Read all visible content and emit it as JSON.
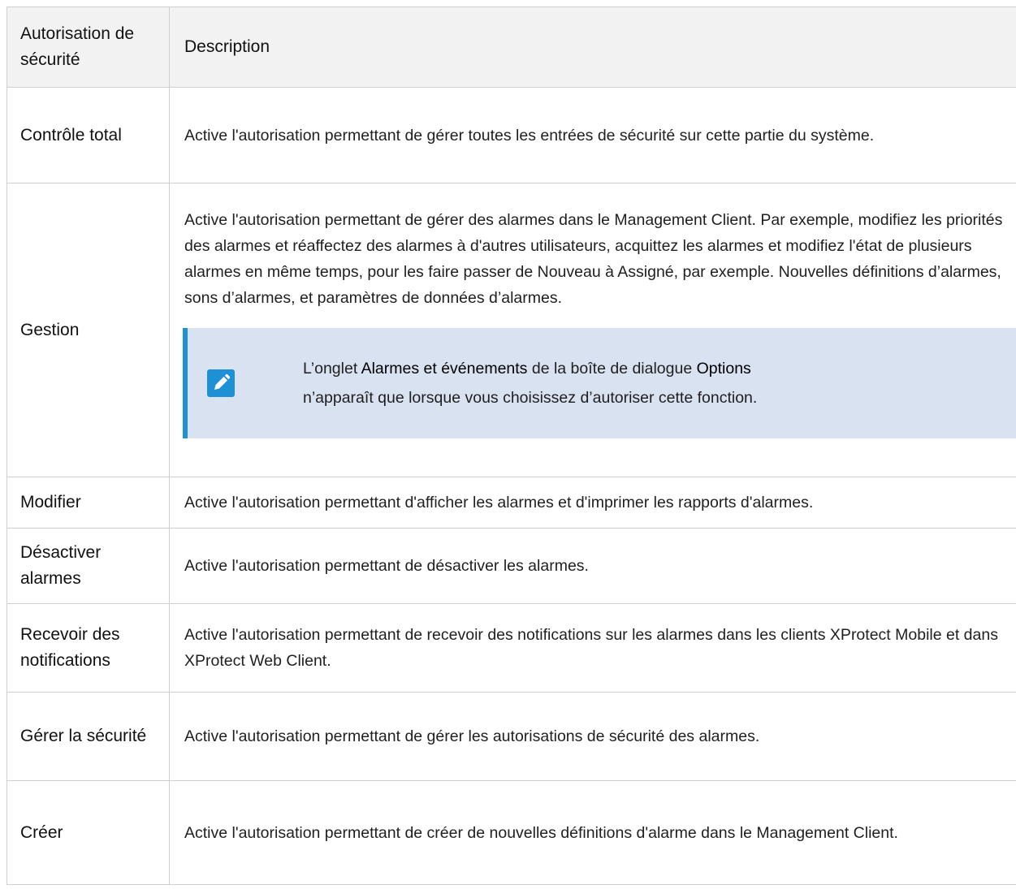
{
  "table": {
    "headers": {
      "permission": "Autorisation de sécurité",
      "description": "Description"
    },
    "rows": [
      {
        "name": "Contrôle total",
        "description": "Active l'autorisation permettant de gérer toutes les entrées de sécurité sur cette partie du système."
      },
      {
        "name": "Gestion",
        "description": "Active l'autorisation permettant de gérer des alarmes dans le Management Client. Par exemple, modifiez les priorités des alarmes et réaffectez des alarmes à d'autres utilisateurs, acquittez les alarmes et modifiez l'état de plusieurs alarmes en même temps, pour les faire passer de Nouveau à Assigné, par exemple. Nouvelles définitions d’alarmes, sons d’alarmes, et paramètres de données d’alarmes."
      },
      {
        "name": "Modifier",
        "description": "Active l'autorisation permettant d'afficher les alarmes et d'imprimer les rapports d'alarmes."
      },
      {
        "name": "Désactiver alarmes",
        "description": "Active l'autorisation permettant de désactiver les alarmes."
      },
      {
        "name": "Recevoir des notifications",
        "description": "Active l'autorisation permettant de recevoir des notifications sur les alarmes dans les clients XProtect Mobile et dans XProtect Web Client."
      },
      {
        "name": "Gérer la sécurité",
        "description": "Active l'autorisation permettant de gérer les autorisations de sécurité des alarmes."
      },
      {
        "name": "Créer",
        "description": "Active l'autorisation permettant de créer de nouvelles définitions d'alarme dans le Management Client."
      }
    ]
  },
  "note": {
    "icon": "pencil-icon",
    "part1": "L’onglet ",
    "bold1": "Alarmes et événements",
    "part2": " de la boîte de dialogue ",
    "bold2": "Options",
    "part3": "n’apparaît que lorsque vous choisissez d’autoriser cette fonction."
  },
  "colors": {
    "note_bg": "#d9e2f1",
    "note_accent": "#1e90d6",
    "header_bg": "#f2f2f2",
    "border": "#cfcfcf"
  }
}
